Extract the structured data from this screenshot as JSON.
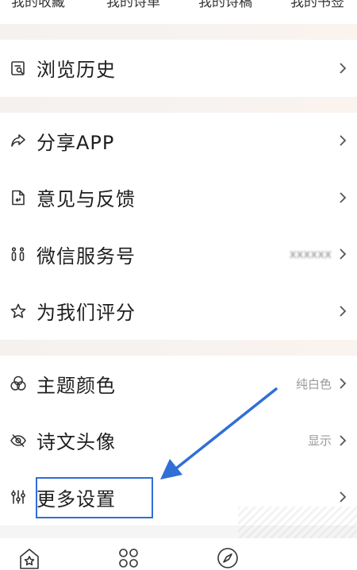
{
  "top_tabs": [
    "我的收藏",
    "我的诗单",
    "我的诗稿",
    "我的书签"
  ],
  "menu_groups": [
    [
      {
        "name": "history",
        "icon": "browse-history-icon",
        "label": "浏览历史",
        "value": ""
      }
    ],
    [
      {
        "name": "share-app",
        "icon": "share-icon",
        "label": "分享APP",
        "value": ""
      },
      {
        "name": "feedback",
        "icon": "feedback-document-icon",
        "label": "意见与反馈",
        "value": ""
      },
      {
        "name": "wechat-service",
        "icon": "wechat-service-icon",
        "label": "微信服务号",
        "value": "xxxxxx",
        "blurred": true
      },
      {
        "name": "rate-us",
        "icon": "star-icon",
        "label": "为我们评分",
        "value": ""
      }
    ],
    [
      {
        "name": "theme-color",
        "icon": "theme-color-icon",
        "label": "主题颜色",
        "value": "纯白色"
      },
      {
        "name": "poem-avatar",
        "icon": "eye-hidden-icon",
        "label": "诗文头像",
        "value": "显示"
      },
      {
        "name": "more-settings",
        "icon": "settings-sliders-icon",
        "label": "更多设置",
        "value": ""
      }
    ]
  ],
  "bottom_nav": [
    {
      "name": "home",
      "icon": "home-icon"
    },
    {
      "name": "discover",
      "icon": "grid-clover-icon"
    },
    {
      "name": "explore",
      "icon": "compass-icon"
    }
  ],
  "annotation": {
    "arrow_color": "#2f6fd6",
    "box_color": "#2f6fd6"
  }
}
